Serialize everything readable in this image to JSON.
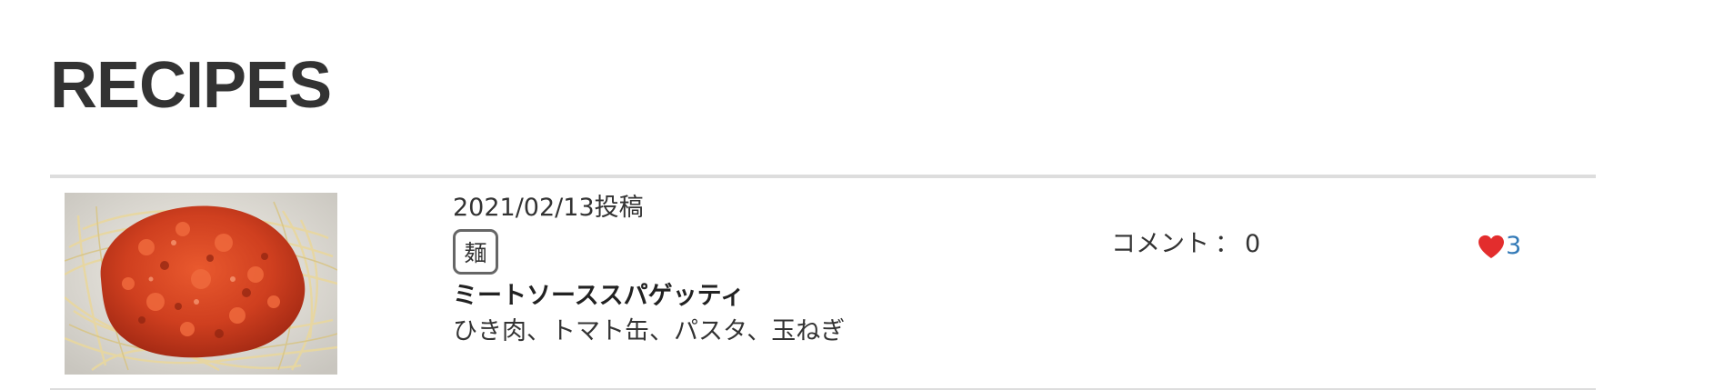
{
  "page": {
    "title": "RECIPES"
  },
  "recipes": [
    {
      "post_date": "2021/02/13投稿",
      "category": "麺",
      "title": "ミートソーススパゲッティ",
      "ingredients": "ひき肉、トマト缶、パスタ、玉ねぎ",
      "comment_label": "コメント",
      "comment_separator": "：",
      "comment_count": "0",
      "like_count": "3",
      "image_icon": "spaghetti-photo"
    }
  ],
  "colors": {
    "heart": "#e32d2d",
    "like_count": "#337ab7",
    "text": "#333333",
    "divider": "#dddddd"
  }
}
